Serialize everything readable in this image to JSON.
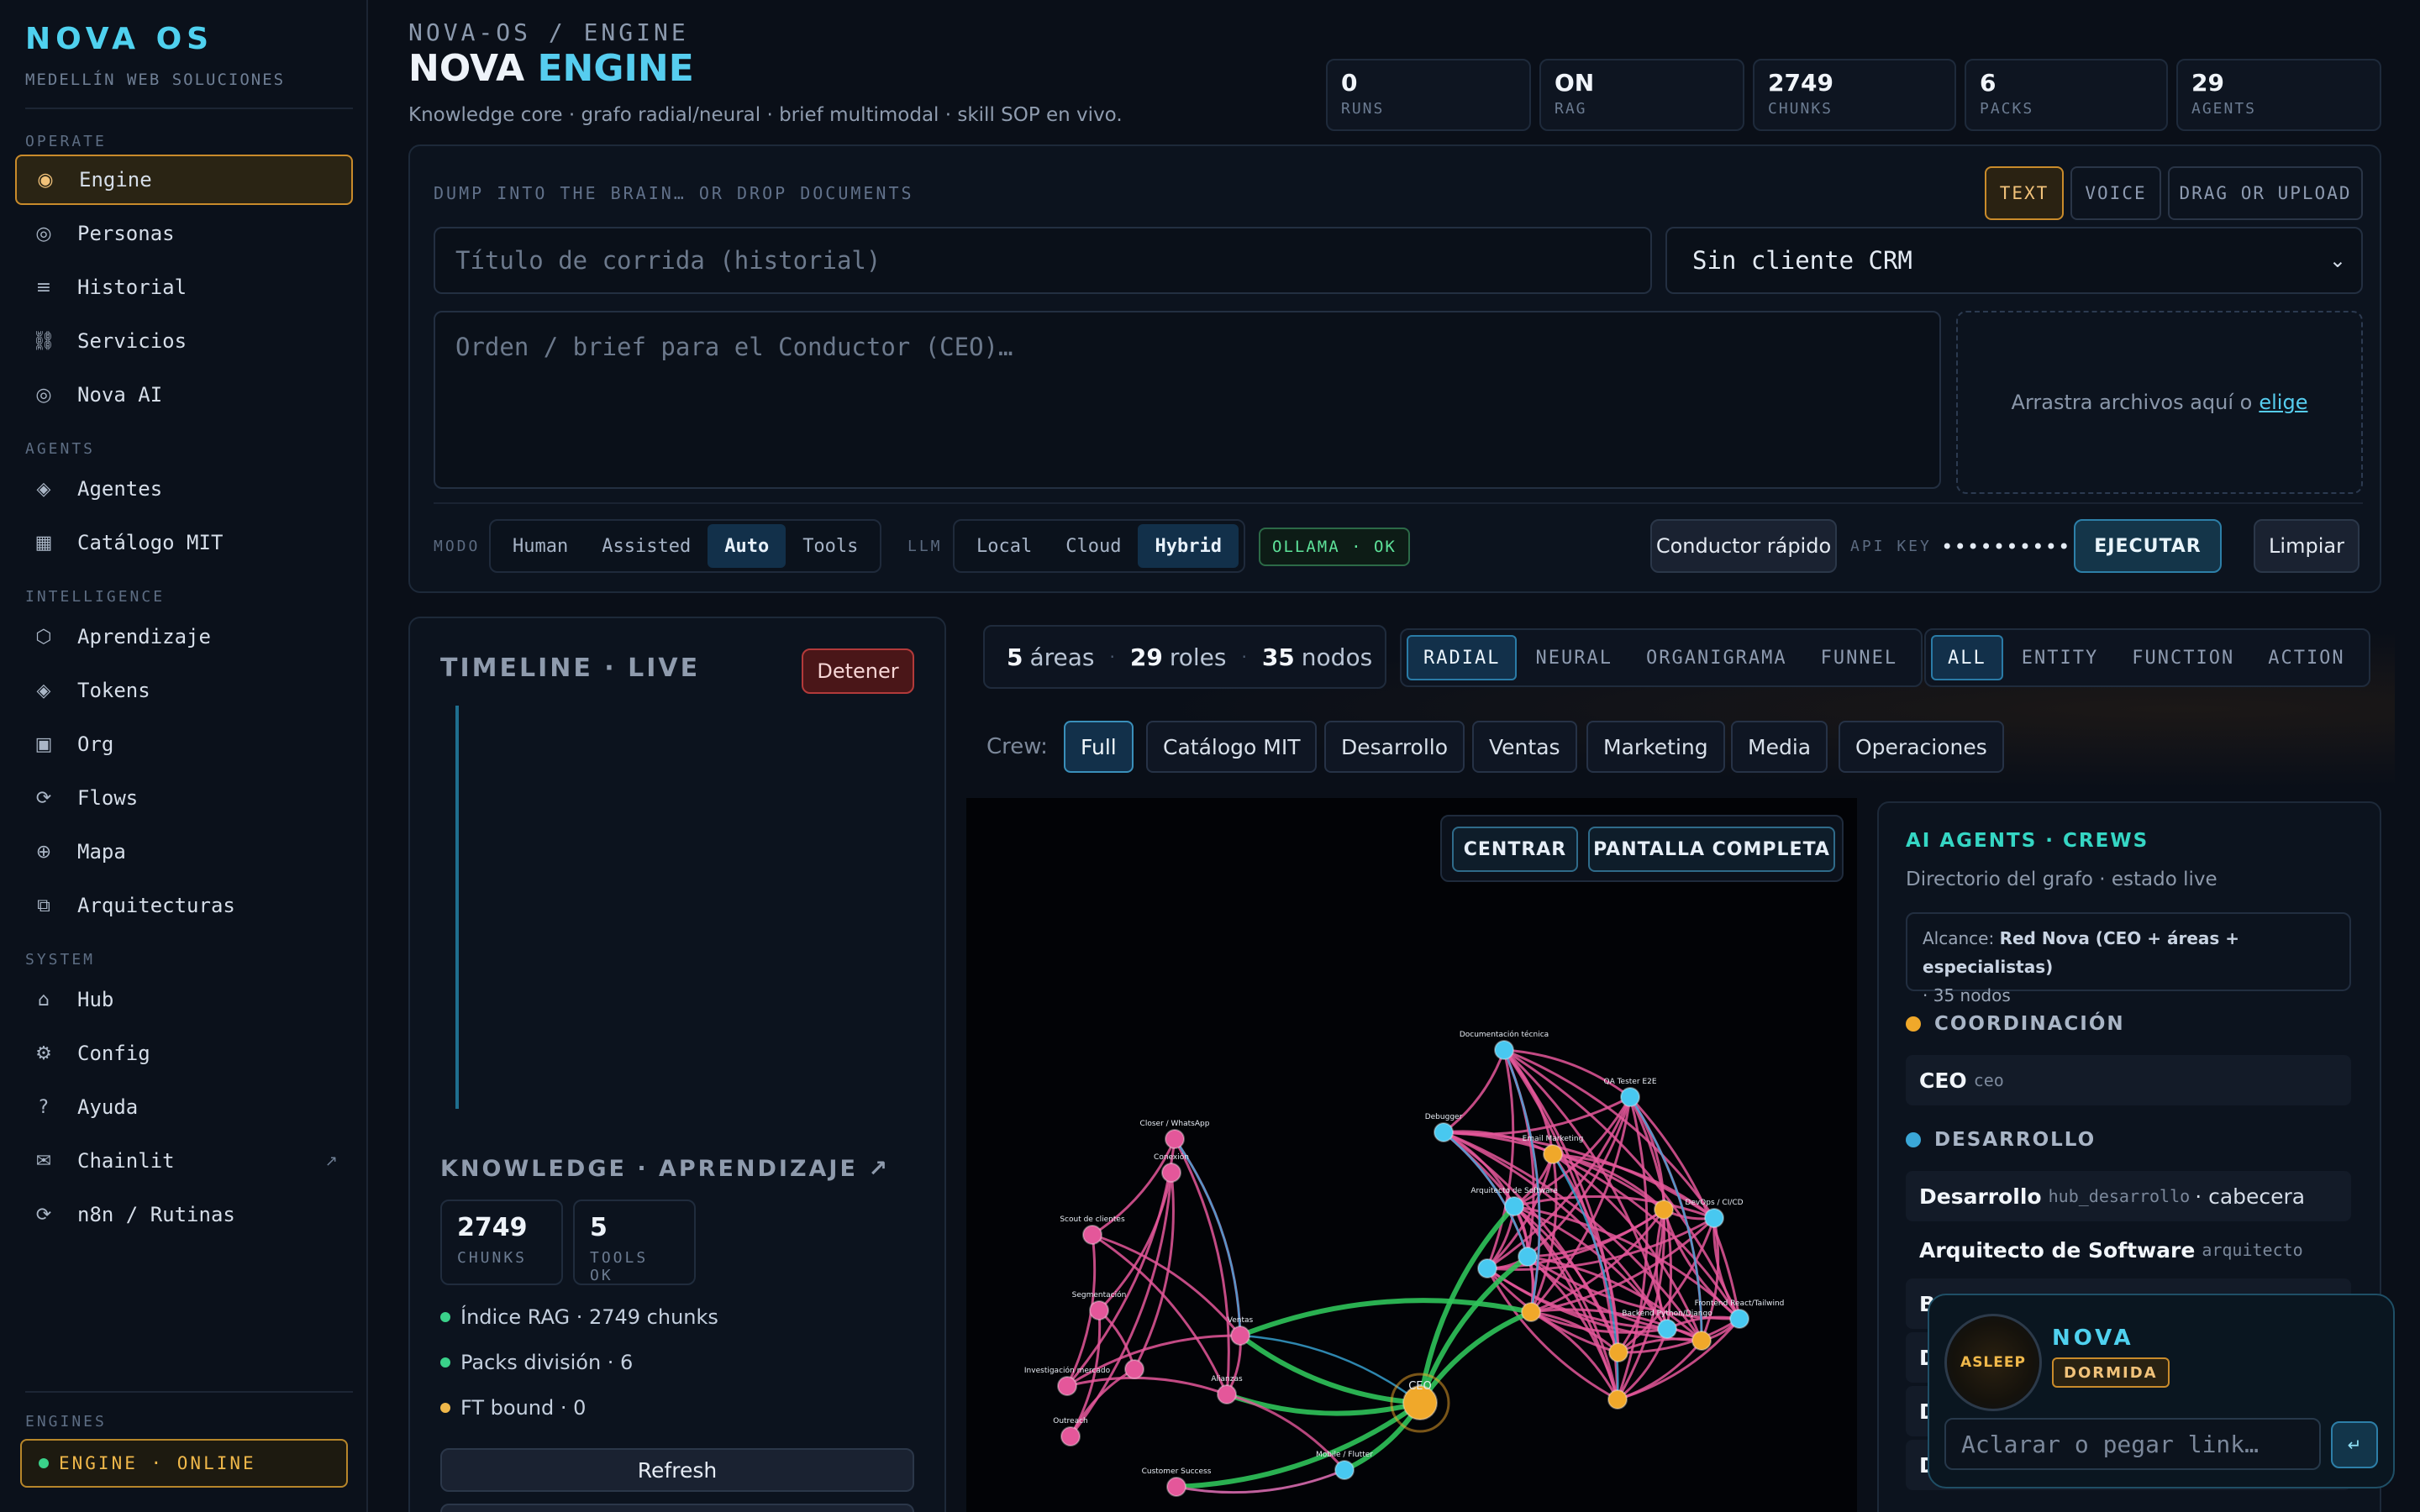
{
  "sidebar": {
    "brand": "NOVA OS",
    "brand_sub": "MEDELLÍN WEB SOLUCIONES",
    "sections": [
      {
        "title": "OPERATE",
        "items": [
          {
            "label": "Engine",
            "icon": "target-icon",
            "glyph": "◉",
            "active": true
          },
          {
            "label": "Personas",
            "icon": "persona-icon",
            "glyph": "◎"
          },
          {
            "label": "Historial",
            "icon": "list-icon",
            "glyph": "≡"
          },
          {
            "label": "Servicios",
            "icon": "link-icon",
            "glyph": "⛓"
          },
          {
            "label": "Nova AI",
            "icon": "nova-icon",
            "glyph": "◎"
          }
        ]
      },
      {
        "title": "AGENTS",
        "items": [
          {
            "label": "Agentes",
            "icon": "diamond-icon",
            "glyph": "◈"
          },
          {
            "label": "Catálogo MIT",
            "icon": "grid-icon",
            "glyph": "▦"
          }
        ]
      },
      {
        "title": "INTELLIGENCE",
        "items": [
          {
            "label": "Aprendizaje",
            "icon": "hexagon-icon",
            "glyph": "⬡"
          },
          {
            "label": "Tokens",
            "icon": "diamond-icon",
            "glyph": "◈"
          },
          {
            "label": "Org",
            "icon": "square-icon",
            "glyph": "▣"
          },
          {
            "label": "Flows",
            "icon": "refresh-icon",
            "glyph": "⟳"
          },
          {
            "label": "Mapa",
            "icon": "globe-icon",
            "glyph": "⊕"
          },
          {
            "label": "Arquitecturas",
            "icon": "layers-icon",
            "glyph": "⧉"
          }
        ]
      },
      {
        "title": "SYSTEM",
        "items": [
          {
            "label": "Hub",
            "icon": "home-icon",
            "glyph": "⌂"
          },
          {
            "label": "Config",
            "icon": "gear-icon",
            "glyph": "⚙"
          },
          {
            "label": "Ayuda",
            "icon": "help-icon",
            "glyph": "?"
          },
          {
            "label": "Chainlit",
            "icon": "mail-icon",
            "glyph": "✉",
            "external": "↗"
          },
          {
            "label": "n8n / Rutinas",
            "icon": "refresh-icon",
            "glyph": "⟳"
          }
        ]
      }
    ],
    "engines_title": "ENGINES",
    "engine_status": "ENGINE · ONLINE"
  },
  "header": {
    "crumb": "NOVA-OS / ENGINE",
    "title_a": "NOVA",
    "title_b": "ENGINE",
    "subtitle": "Knowledge core · grafo radial/neural · brief multimodal · skill SOP en vivo.",
    "stats": [
      {
        "value": "0",
        "label": "RUNS"
      },
      {
        "value": "ON",
        "label": "RAG"
      },
      {
        "value": "2749",
        "label": "CHUNKS"
      },
      {
        "value": "6",
        "label": "PACKS"
      },
      {
        "value": "29",
        "label": "AGENTS"
      }
    ]
  },
  "input_panel": {
    "dump_label": "DUMP INTO THE BRAIN… OR DROP DOCUMENTS",
    "input_modes": [
      "TEXT",
      "VOICE",
      "DRAG OR UPLOAD"
    ],
    "title_placeholder": "Título de corrida (historial)",
    "crm_selected": "Sin cliente CRM",
    "brief_placeholder": "Orden / brief para el Conductor (CEO)…",
    "drop_text": "Arrastra archivos aquí o",
    "drop_link": "elige",
    "mode_label": "MODO",
    "modes": [
      "Human",
      "Assisted",
      "Auto",
      "Tools"
    ],
    "llm_label": "LLM",
    "llms": [
      "Local",
      "Cloud",
      "Hybrid"
    ],
    "ollama": "OLLAMA · OK",
    "quick_btn": "Conductor rápido",
    "api_label": "API KEY",
    "api_value": "••••••••••••••••••",
    "execute": "EJECUTAR",
    "clear": "Limpiar"
  },
  "timeline": {
    "title": "TIMELINE · LIVE",
    "stop": "Detener",
    "knowledge_title": "KNOWLEDGE · APRENDIZAJE ↗",
    "stats": [
      {
        "value": "2749",
        "label": "CHUNKS"
      },
      {
        "value": "5",
        "label": "TOOLS OK"
      }
    ],
    "lines": [
      {
        "text": "Índice RAG · 2749 chunks",
        "color": "#3ad18a"
      },
      {
        "text": "Packs división · 6",
        "color": "#3ad18a"
      },
      {
        "text": "FT bound · 0",
        "color": "#f0b84a"
      }
    ],
    "refresh": "Refresh"
  },
  "graph": {
    "areas": "5",
    "areas_label": "áreas",
    "roles": "29",
    "roles_label": "roles",
    "nodes": "35",
    "nodes_label": "nodos",
    "views": [
      "RADIAL",
      "NEURAL",
      "ORGANIGRAMA",
      "FUNNEL"
    ],
    "filters": [
      "ALL",
      "ENTITY",
      "FUNCTION",
      "ACTION"
    ],
    "crew_label": "Crew:",
    "crews": [
      "Full",
      "Catálogo MIT",
      "Desarrollo",
      "Ventas",
      "Marketing",
      "Media",
      "Operaciones"
    ],
    "center": "CENTRAR",
    "fullscreen": "PANTALLA COMPLETA",
    "node_labels": [
      "Documentación técnica",
      "QA Tester E2E",
      "Debugger",
      "Email Marketing",
      "Arquitecto de Software",
      "Closer / WhatsApp",
      "Conexión",
      "Scout de clientes",
      "Segmentación",
      "Investigación mercado",
      "Outreach",
      "Ventas",
      "CEO",
      "Backend Python/Django",
      "Frontend React/Tailwind",
      "Customer Success",
      "Mobile / Flutter",
      "Alianzas",
      "DevOps / CI/CD"
    ],
    "colors": {
      "pink": "#e4579a",
      "blue": "#3aa7d8",
      "green": "#2fc35a",
      "cyan": "#48c8f0",
      "orange": "#f0a82a"
    }
  },
  "agents": {
    "title": "AI AGENTS · CREWS",
    "subtitle": "Directorio del grafo · estado live",
    "scope_label": "Alcance:",
    "scope_value": "Red Nova (CEO + áreas + especialistas)",
    "scope_count": "· 35 nodos",
    "groups": [
      {
        "name": "COORDINACIÓN",
        "color": "#f0a82a",
        "rows": [
          {
            "name": "CEO",
            "slug": "ceo"
          }
        ]
      },
      {
        "name": "DESARROLLO",
        "color": "#3aa7d8",
        "rows": [
          {
            "name": "Desarrollo",
            "slug": "hub_desarrollo",
            "extra": "· cabecera"
          },
          {
            "name": "Arquitecto de Software",
            "slug": "arquitecto"
          },
          {
            "name": "B",
            "slug": ""
          },
          {
            "name": "D",
            "slug": ""
          },
          {
            "name": "D",
            "slug": ""
          },
          {
            "name": "D",
            "slug": ""
          }
        ]
      }
    ]
  },
  "nova": {
    "orb": "ASLEEP",
    "name": "NOVA",
    "state": "DORMIDA",
    "placeholder": "Aclarar o pegar link…",
    "send": "↵"
  }
}
